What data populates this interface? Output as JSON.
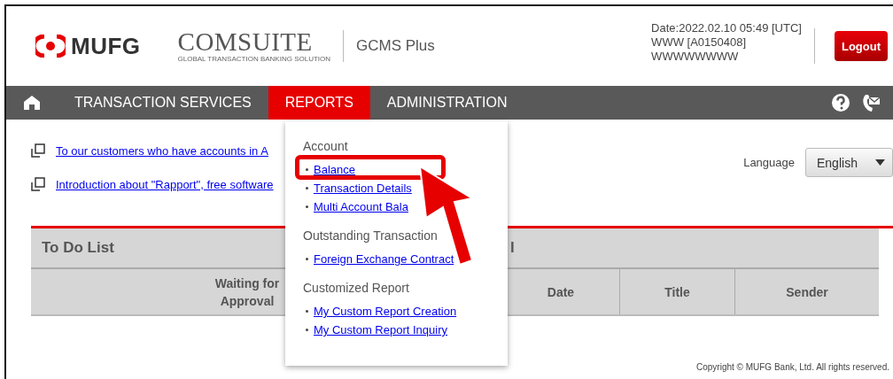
{
  "header": {
    "logo": "MUFG",
    "product": "COMSUITE",
    "tagline": "GLOBAL TRANSACTION BANKING SOLUTION",
    "edition": "GCMS Plus",
    "session": [
      "Date:2022.02.10 05:49 [UTC]",
      "WWW [A0150408]",
      "WWWWWWWW"
    ],
    "logout": "Logout"
  },
  "nav": {
    "items": [
      {
        "label": "TRANSACTION SERVICES",
        "selected": false
      },
      {
        "label": "REPORTS",
        "selected": true
      },
      {
        "label": "ADMINISTRATION",
        "selected": false
      }
    ]
  },
  "links": [
    "To our customers who have accounts in A",
    "Introduction about \"Rapport\", free software"
  ],
  "language": {
    "label": "Language",
    "value": "English"
  },
  "panels": [
    {
      "title": "To Do List",
      "columns": [
        "Waiting for Approval"
      ]
    },
    {
      "title": "l",
      "columns": [
        "",
        "Date",
        "Title",
        "Sender"
      ]
    }
  ],
  "dropdown": {
    "sections": [
      {
        "heading": "Account",
        "items": [
          {
            "label": "Balance",
            "highlighted": true
          },
          {
            "label": "Transaction Details",
            "highlighted": false
          },
          {
            "label": "Multi Account Bala",
            "highlighted": false
          }
        ]
      },
      {
        "heading": "Outstanding Transaction",
        "items": [
          {
            "label": "Foreign Exchange Contract",
            "highlighted": false
          }
        ]
      },
      {
        "heading": "Customized Report",
        "items": [
          {
            "label": "My Custom Report Creation",
            "highlighted": false
          },
          {
            "label": "My Custom Report Inquiry",
            "highlighted": false
          }
        ]
      }
    ]
  },
  "footer": {
    "copyright": "Copyright © MUFG Bank, Ltd. All rights reserved."
  }
}
